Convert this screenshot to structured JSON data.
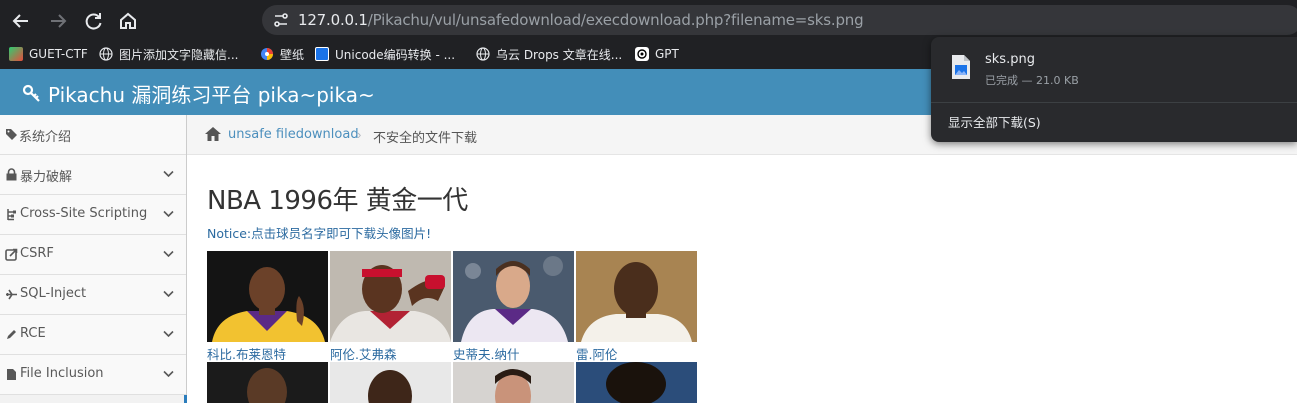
{
  "browser": {
    "url_host": "127.0.0.1",
    "url_path": "/Pikachu/vul/unsafedownload/execdownload.php?filename=sks.png",
    "bookmarks": [
      {
        "label": "GUET-CTF",
        "icon": "guet-icon"
      },
      {
        "label": "图片添加文字隐藏信...",
        "icon": "globe-icon"
      },
      {
        "label": "壁纸",
        "icon": "wallpaper-icon"
      },
      {
        "label": "Unicode编码转换 - ...",
        "icon": "unicode-icon"
      },
      {
        "label": "乌云 Drops 文章在线...",
        "icon": "globe-icon"
      },
      {
        "label": "GPT",
        "icon": "openai-icon"
      }
    ]
  },
  "download": {
    "filename": "sks.png",
    "status": "已完成 — 21.0 KB",
    "show_all": "显示全部下载(S)"
  },
  "header": {
    "brand": "Pikachu 漏洞练习平台 pika~pika~"
  },
  "sidebar": {
    "items": [
      {
        "label": "系统介绍",
        "icon": "tags-icon",
        "has_chevron": false
      },
      {
        "label": "暴力破解",
        "icon": "lock-icon",
        "has_chevron": true
      },
      {
        "label": "Cross-Site Scripting",
        "icon": "sitemap-icon",
        "has_chevron": true
      },
      {
        "label": "CSRF",
        "icon": "share-icon",
        "has_chevron": true
      },
      {
        "label": "SQL-Inject",
        "icon": "plane-icon",
        "has_chevron": true
      },
      {
        "label": "RCE",
        "icon": "pencil-icon",
        "has_chevron": true
      },
      {
        "label": "File Inclusion",
        "icon": "file-icon",
        "has_chevron": true
      }
    ]
  },
  "breadcrumb": {
    "link": "unsafe filedownload",
    "current": "不安全的文件下载"
  },
  "main": {
    "title": "NBA 1996年 黄金一代",
    "notice": "Notice:点击球员名字即可下载头像图片!",
    "players": [
      {
        "name": "科比.布莱恩特"
      },
      {
        "name": "阿伦.艾弗森"
      },
      {
        "name": "史蒂夫.纳什"
      },
      {
        "name": "雷.阿伦"
      }
    ]
  },
  "colors": {
    "header_bg": "#438eb9",
    "link": "#2b6aa0",
    "chrome_bg": "#202124"
  }
}
